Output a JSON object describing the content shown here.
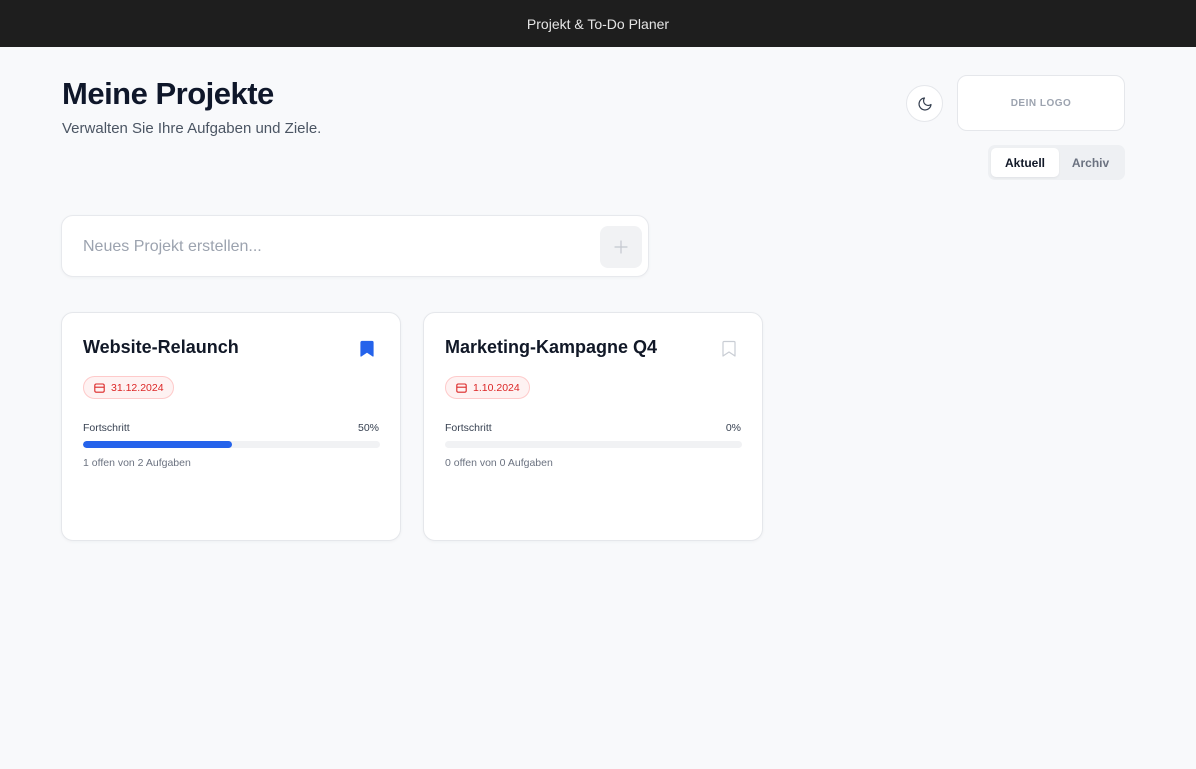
{
  "app": {
    "title": "Projekt & To-Do Planer"
  },
  "header": {
    "title": "Meine Projekte",
    "subtitle": "Verwalten Sie Ihre Aufgaben und Ziele."
  },
  "logo": {
    "text": "DEIN LOGO"
  },
  "theme_toggle": {
    "icon": "moon-icon"
  },
  "tabs": [
    {
      "label": "Aktuell",
      "active": true
    },
    {
      "label": "Archiv",
      "active": false
    }
  ],
  "new_project": {
    "placeholder": "Neues Projekt erstellen...",
    "value": "",
    "add_icon": "plus-icon"
  },
  "colors": {
    "accent": "#2563eb",
    "danger": "#dc2626",
    "topbar": "#1e1e1e"
  },
  "projects": [
    {
      "name": "Website-Relaunch",
      "bookmarked": true,
      "date": "31.12.2024",
      "progress_label": "Fortschritt",
      "progress_percent": 50,
      "progress_text": "50%",
      "tasks_text": "1 offen von 2 Aufgaben"
    },
    {
      "name": "Marketing-Kampagne Q4",
      "bookmarked": false,
      "date": "1.10.2024",
      "progress_label": "Fortschritt",
      "progress_percent": 0,
      "progress_text": "0%",
      "tasks_text": "0 offen von 0 Aufgaben"
    }
  ]
}
